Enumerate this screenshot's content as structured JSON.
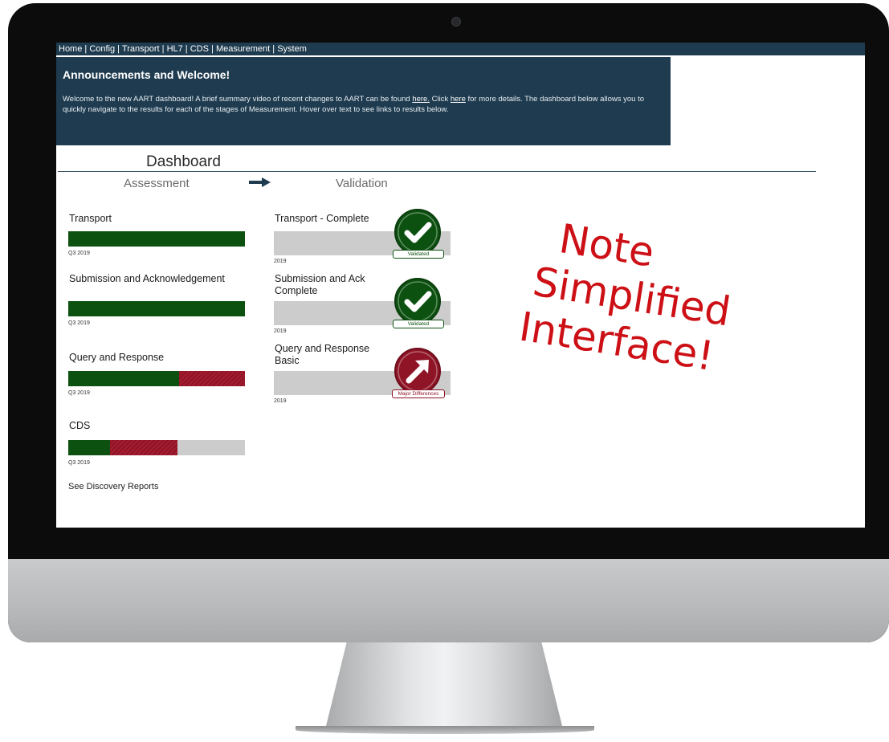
{
  "nav": {
    "items": [
      "Home",
      "Config",
      "Transport",
      "HL7",
      "CDS",
      "Measurement",
      "System"
    ],
    "separator": " | "
  },
  "announcement": {
    "title": "Announcements and Welcome!",
    "text_1": "Welcome to the new AART dashboard! A brief summary video of recent changes to AART can be found ",
    "link_1": "here.",
    "text_2": " Click ",
    "link_2": "here",
    "text_3": " for more details. The dashboard below allows you to quickly navigate to the results for each of the stages of Measurement. Hover over text to see links to results below."
  },
  "dashboard": {
    "title": "Dashboard",
    "assessment_heading": "Assessment",
    "validation_heading": "Validation"
  },
  "assessment": [
    {
      "label": "Transport",
      "date": "Q3 2019",
      "green_fraction": 1.0,
      "red_fraction": 0.0
    },
    {
      "label": "Submission and Acknowledgement",
      "date": "Q3 2019",
      "green_fraction": 1.0,
      "red_fraction": 0.0
    },
    {
      "label": "Query and Response",
      "date": "Q3 2019",
      "green_fraction": 0.625,
      "red_fraction": 0.375
    },
    {
      "label": "CDS",
      "date": "Q3 2019",
      "green_fraction": 0.235,
      "red_fraction": 0.385
    }
  ],
  "validation": [
    {
      "label": "Transport - Complete",
      "date": "2019",
      "status": "Validated"
    },
    {
      "label": "Submission and Ack Complete",
      "date": "2019",
      "status": "Validated"
    },
    {
      "label": "Query and Response Basic",
      "date": "2019",
      "status": "Major Differences"
    }
  ],
  "discovery_link": "See Discovery Reports",
  "note": {
    "line1": "Note",
    "line2": "Simplified",
    "line3": "Interface!"
  },
  "colors": {
    "navy": "#1e3b4f",
    "green": "#0c5110",
    "red": "#a51c30",
    "note_red": "#cc1016",
    "bar_gray": "#cccccc"
  },
  "icons": {
    "validated": "checkmark-icon",
    "major_differences": "arrow-up-right-icon",
    "flow": "arrow-right-icon",
    "camera": "camera-icon"
  }
}
